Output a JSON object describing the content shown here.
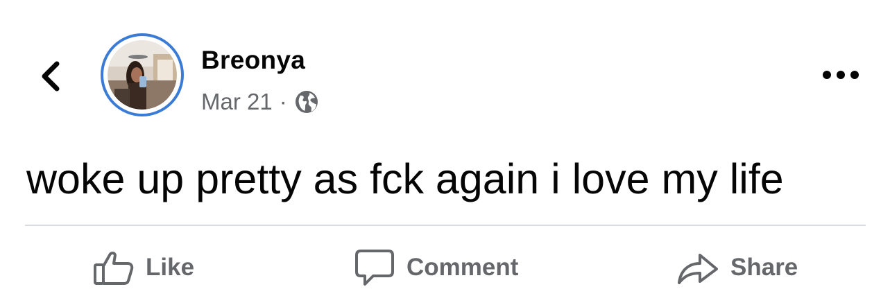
{
  "post": {
    "author": "Breonya",
    "date": "Mar 21",
    "separator": "·",
    "privacy_icon": "globe-icon",
    "text": "woke up pretty as fck again i love my life"
  },
  "header": {
    "back_icon": "chevron-left-icon",
    "more_icon": "more-horizontal-icon"
  },
  "colors": {
    "avatar_ring": "#3a7bd5",
    "meta_text": "#65676b",
    "action_text": "#65676b",
    "divider": "#dadde1"
  },
  "actions": [
    {
      "label": "Like",
      "icon": "thumbs-up-icon"
    },
    {
      "label": "Comment",
      "icon": "comment-bubble-icon"
    },
    {
      "label": "Share",
      "icon": "share-arrow-icon"
    }
  ]
}
